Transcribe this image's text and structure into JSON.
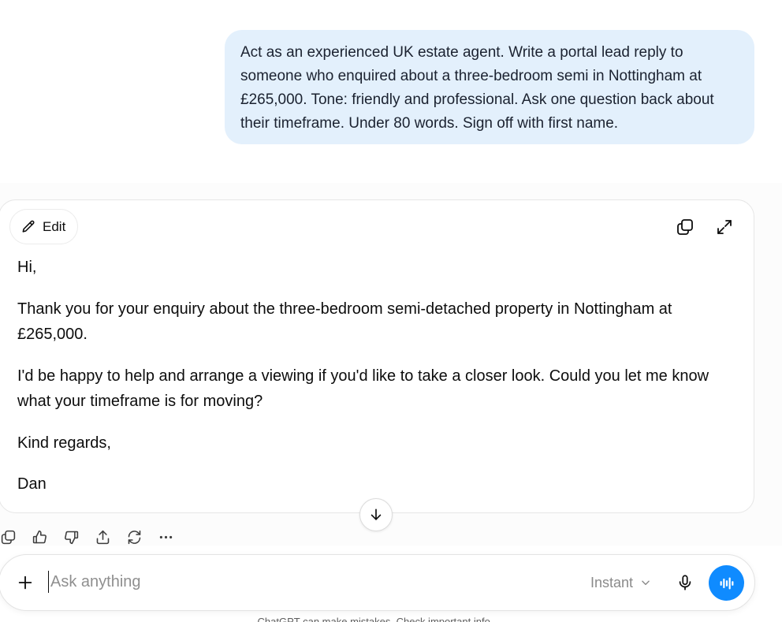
{
  "user_message": "Act as an experienced UK estate agent. Write a portal lead reply to someone who enquired about a three-bedroom semi in Nottingham at £265,000. Tone: friendly and professional. Ask one question back about their timeframe. Under 80 words. Sign off with first name.",
  "canvas": {
    "edit_label": "Edit",
    "paragraphs": [
      "Hi,",
      "Thank you for your enquiry about the three-bedroom semi-detached property in Nottingham at £265,000.",
      "I'd be happy to help and arrange a viewing if you'd like to take a closer look. Could you let me know what your timeframe is for moving?",
      "Kind regards,",
      "Dan"
    ]
  },
  "actions": {
    "icons": [
      "copy-icon",
      "thumbs-up-icon",
      "thumbs-down-icon",
      "share-icon",
      "regenerate-icon",
      "more-icon"
    ]
  },
  "composer": {
    "placeholder": "Ask anything",
    "mode_label": "Instant"
  },
  "disclaimer": "ChatGPT can make mistakes. Check important info.",
  "colors": {
    "user_bubble": "#e3f0fc",
    "accent": "#0f8bff"
  }
}
